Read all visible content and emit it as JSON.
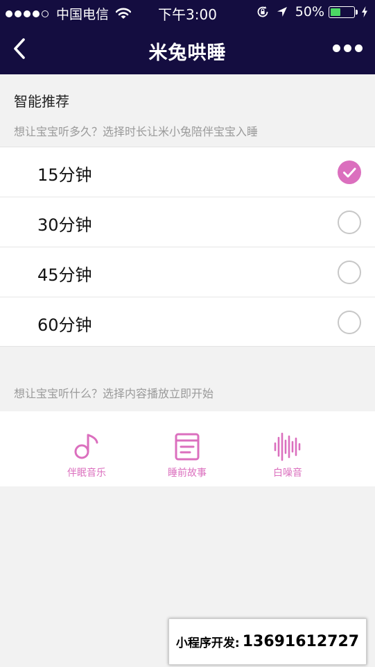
{
  "status_bar": {
    "carrier": "中国电信",
    "time": "下午3:00",
    "battery_percent": "50%",
    "battery_level": 0.5,
    "signal_bars_filled": 4,
    "signal_bars_total": 5,
    "icons": [
      "signal-dots-icon",
      "wifi-icon",
      "orientation-lock-icon",
      "location-arrow-icon",
      "battery-icon",
      "charging-bolt-icon"
    ]
  },
  "nav": {
    "title": "米兔哄睡",
    "back_icon": "chevron-left-icon",
    "more_icon": "more-dots-icon"
  },
  "recommend": {
    "title": "智能推荐",
    "subtitle": "想让宝宝听多久？选择时长让米小兔陪伴宝宝入睡",
    "options": [
      {
        "label": "15分钟",
        "selected": true
      },
      {
        "label": "30分钟",
        "selected": false
      },
      {
        "label": "45分钟",
        "selected": false
      },
      {
        "label": "60分钟",
        "selected": false
      }
    ]
  },
  "content": {
    "subtitle": "想让宝宝听什么？选择内容播放立即开始",
    "categories": [
      {
        "label": "伴眠音乐",
        "icon": "music-note-icon"
      },
      {
        "label": "睡前故事",
        "icon": "story-book-icon"
      },
      {
        "label": "白噪音",
        "icon": "sound-wave-icon"
      }
    ]
  },
  "contact": {
    "label": "小程序开发:",
    "phone": "13691612727"
  },
  "colors": {
    "header_bg": "#140d40",
    "accent": "#db6fbe",
    "page_bg": "#f2f2f2",
    "battery_fill": "#4cd964"
  }
}
